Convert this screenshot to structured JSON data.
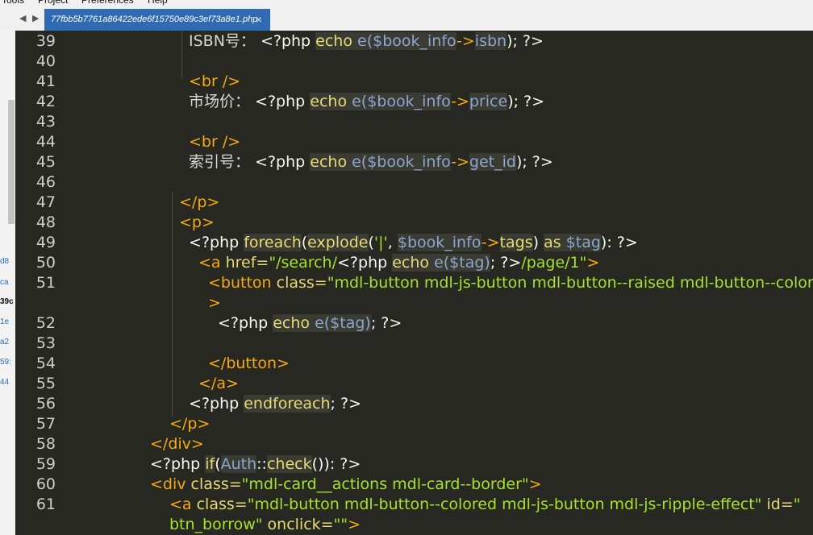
{
  "menu": [
    "Tools",
    "Project",
    "Preferences",
    "Help"
  ],
  "tab": {
    "title": "77fbb5b7761a86422ede6f15750e89c3ef73a8e1.php",
    "close": "×"
  },
  "nav": {
    "back": "◀",
    "forward": "▶"
  },
  "sidebar_fragments": [
    "d8",
    "ca",
    "39c",
    "1e",
    "a2",
    "59:",
    "44"
  ],
  "code_lines": [
    {
      "n": "39",
      "indent": 215,
      "t": [
        {
          "c": "dim",
          "s": "ISBN号： "
        },
        {
          "c": "kw",
          "s": "<?php "
        },
        {
          "c": "fn",
          "s": "echo "
        },
        {
          "c": "var",
          "s": "e("
        },
        {
          "c": "var",
          "s": "$book_info"
        },
        {
          "c": "tag",
          "s": "->"
        },
        {
          "c": "var",
          "s": "isbn"
        },
        {
          "c": "kw",
          "s": "); ?>"
        }
      ]
    },
    {
      "n": "40",
      "indent": 215,
      "t": []
    },
    {
      "n": "41",
      "indent": 215,
      "t": [
        {
          "c": "tag",
          "s": "<br />"
        }
      ]
    },
    {
      "n": "42",
      "indent": 215,
      "t": [
        {
          "c": "dim",
          "s": "市场价： "
        },
        {
          "c": "kw",
          "s": "<?php "
        },
        {
          "c": "fn",
          "s": "echo "
        },
        {
          "c": "var",
          "s": "e("
        },
        {
          "c": "var",
          "s": "$book_info"
        },
        {
          "c": "tag",
          "s": "->"
        },
        {
          "c": "var",
          "s": "price"
        },
        {
          "c": "kw",
          "s": "); ?>"
        }
      ]
    },
    {
      "n": "43",
      "indent": 215,
      "t": []
    },
    {
      "n": "44",
      "indent": 215,
      "t": [
        {
          "c": "tag",
          "s": "<br />"
        }
      ]
    },
    {
      "n": "45",
      "indent": 215,
      "t": [
        {
          "c": "dim",
          "s": "索引号： "
        },
        {
          "c": "kw",
          "s": "<?php "
        },
        {
          "c": "fn",
          "s": "echo "
        },
        {
          "c": "var",
          "s": "e("
        },
        {
          "c": "var",
          "s": "$book_info"
        },
        {
          "c": "tag",
          "s": "->"
        },
        {
          "c": "var",
          "s": "get_id"
        },
        {
          "c": "kw",
          "s": "); ?>"
        }
      ]
    },
    {
      "n": "46",
      "indent": 215,
      "t": []
    },
    {
      "n": "47",
      "indent": 203,
      "t": [
        {
          "c": "tag",
          "s": "</p>"
        }
      ]
    },
    {
      "n": "48",
      "indent": 203,
      "t": [
        {
          "c": "tag",
          "s": "<p>"
        }
      ]
    },
    {
      "n": "49",
      "indent": 215,
      "t": [
        {
          "c": "kw",
          "s": "<?php "
        },
        {
          "c": "fn",
          "s": "foreach"
        },
        {
          "c": "kw",
          "s": "("
        },
        {
          "c": "fn",
          "s": "explode"
        },
        {
          "c": "kw",
          "s": "("
        },
        {
          "c": "str",
          "s": "'|'"
        },
        {
          "c": "kw",
          "s": ", "
        },
        {
          "c": "var",
          "s": "$book_info"
        },
        {
          "c": "tag",
          "s": "->"
        },
        {
          "c": "fn",
          "s": "tags"
        },
        {
          "c": "kw",
          "s": ") "
        },
        {
          "c": "fn",
          "s": "as "
        },
        {
          "c": "var",
          "s": "$tag"
        },
        {
          "c": "kw",
          "s": "): ?>"
        }
      ]
    },
    {
      "n": "50",
      "indent": 227,
      "t": [
        {
          "c": "tag",
          "s": "<a "
        },
        {
          "c": "attr",
          "s": "href="
        },
        {
          "c": "str",
          "s": "\"/search/"
        },
        {
          "c": "kw",
          "s": "<?php "
        },
        {
          "c": "fn",
          "s": "echo "
        },
        {
          "c": "var",
          "s": "e("
        },
        {
          "c": "var",
          "s": "$tag"
        },
        {
          "c": "var",
          "s": ")"
        },
        {
          "c": "kw",
          "s": "; ?>"
        },
        {
          "c": "str",
          "s": "/page/1\""
        },
        {
          "c": "tag",
          "s": ">"
        }
      ]
    },
    {
      "n": "51",
      "indent": 239,
      "t": [
        {
          "c": "tag",
          "s": "<button "
        },
        {
          "c": "attr",
          "s": "class="
        },
        {
          "c": "str",
          "s": "\"mdl-button mdl-js-button mdl-button--raised mdl-button--colored"
        }
      ]
    },
    {
      "n": "",
      "indent": 239,
      "t": [
        {
          "c": "tag",
          "s": ">"
        }
      ]
    },
    {
      "n": "52",
      "indent": 251,
      "t": [
        {
          "c": "kw",
          "s": "<?php "
        },
        {
          "c": "fn",
          "s": "echo "
        },
        {
          "c": "var",
          "s": "e("
        },
        {
          "c": "var",
          "s": "$tag"
        },
        {
          "c": "var",
          "s": ")"
        },
        {
          "c": "kw",
          "s": "; ?>"
        }
      ]
    },
    {
      "n": "53",
      "indent": 239,
      "t": []
    },
    {
      "n": "54",
      "indent": 239,
      "t": [
        {
          "c": "tag",
          "s": "</button>"
        }
      ]
    },
    {
      "n": "55",
      "indent": 227,
      "t": [
        {
          "c": "tag",
          "s": "</a>"
        }
      ]
    },
    {
      "n": "56",
      "indent": 215,
      "t": [
        {
          "c": "kw",
          "s": "<?php "
        },
        {
          "c": "fn",
          "s": "endforeach"
        },
        {
          "c": "kw",
          "s": "; ?>"
        }
      ]
    },
    {
      "n": "57",
      "indent": 191,
      "t": [
        {
          "c": "tag",
          "s": "</p>"
        }
      ]
    },
    {
      "n": "58",
      "indent": 167,
      "t": [
        {
          "c": "tag",
          "s": "</div>"
        }
      ]
    },
    {
      "n": "59",
      "indent": 167,
      "t": [
        {
          "c": "kw",
          "s": "<?php "
        },
        {
          "c": "fn",
          "s": "if"
        },
        {
          "c": "kw",
          "s": "("
        },
        {
          "c": "var",
          "s": "Auth"
        },
        {
          "c": "kw",
          "s": "::"
        },
        {
          "c": "fn",
          "s": "check"
        },
        {
          "c": "kw",
          "s": "()): ?>"
        }
      ]
    },
    {
      "n": "60",
      "indent": 167,
      "t": [
        {
          "c": "tag",
          "s": "<div "
        },
        {
          "c": "attr",
          "s": "class="
        },
        {
          "c": "str",
          "s": "\"mdl-card__actions mdl-card--border\""
        },
        {
          "c": "tag",
          "s": ">"
        }
      ]
    },
    {
      "n": "61",
      "indent": 191,
      "t": [
        {
          "c": "tag",
          "s": "<a "
        },
        {
          "c": "attr",
          "s": "class="
        },
        {
          "c": "str",
          "s": "\"mdl-button mdl-button--colored mdl-js-button mdl-js-ripple-effect\""
        },
        {
          "c": "attr",
          "s": " id="
        },
        {
          "c": "str",
          "s": "\""
        }
      ]
    },
    {
      "n": "",
      "indent": 191,
      "t": [
        {
          "c": "str",
          "s": "btn_borrow\""
        },
        {
          "c": "attr",
          "s": " onclick="
        },
        {
          "c": "str",
          "s": "\"\""
        },
        {
          "c": "tag",
          "s": ">"
        }
      ]
    }
  ]
}
